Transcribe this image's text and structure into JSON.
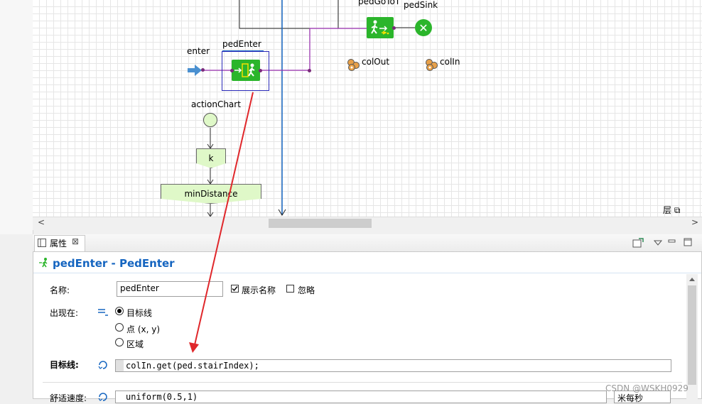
{
  "canvas": {
    "labels": {
      "pedgotot": "pedGoToT",
      "pedsink": "pedSink",
      "enter": "enter",
      "pedenter": "pedEnter",
      "colout": "colOut",
      "colin": "colIn",
      "actionchart": "actionChart",
      "k": "k",
      "mindistance": "minDistance"
    },
    "layer_icons": "层 ⧉"
  },
  "scrollbar": {
    "left": "<",
    "right": ">"
  },
  "properties": {
    "tab_label": "属性",
    "tab_close": "⊠",
    "title": "pedEnter - PedEnter",
    "name_label": "名称:",
    "name_value": "pedEnter",
    "show_name_label": "展示名称",
    "show_name_checked": true,
    "ignore_label": "忽略",
    "ignore_checked": false,
    "appear_label": "出现在:",
    "appear_options": [
      "目标线",
      "点 (x, y)",
      "区域"
    ],
    "appear_selected": 0,
    "target_label": "目标线:",
    "target_value": "colIn.get(ped.stairIndex);",
    "speed_label": "舒适速度:",
    "speed_value": "uniform(0.5,1)",
    "speed_unit": "米每秒"
  },
  "watermark": "CSDN @WSKH0929",
  "colors": {
    "accent_blue": "#1565c0",
    "arrow_red": "#e0272b",
    "green": "#2bb52b",
    "flow_green": "#dff8c8",
    "connector_purple": "#9b30b0"
  }
}
